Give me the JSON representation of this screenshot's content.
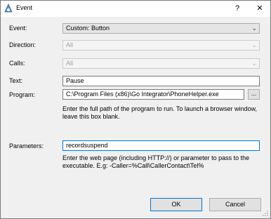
{
  "window": {
    "title": "Event",
    "help_glyph": "?",
    "close_glyph": "✕",
    "icon": "app-icon"
  },
  "fields": {
    "event_label": "Event:",
    "event_value": "Custom: Button",
    "direction_label": "Direction:",
    "direction_value": "All",
    "calls_label": "Calls:",
    "calls_value": "All",
    "text_label": "Text:",
    "text_value": "Pause",
    "program_label": "Program:",
    "program_value": "C:\\Program Files (x86)\\Go Integrator\\PhoneHelper.exe",
    "browse_label": "...",
    "program_hint": "Enter the full path of the program to run. To launch a browser window, leave this box blank.",
    "parameters_label": "Parameters:",
    "parameters_value": "recordsuspend",
    "parameters_hint": "Enter the web page (including HTTP://) or parameter to pass to the executable. E.g: -Caller=%Call\\CallerContact\\Tel%"
  },
  "buttons": {
    "ok_label": "OK",
    "cancel_label": "Cancel"
  },
  "combo_arrow_glyph": "⌄",
  "colors": {
    "focus": "#0078d7",
    "dialog_bg": "#f0f0f0"
  }
}
